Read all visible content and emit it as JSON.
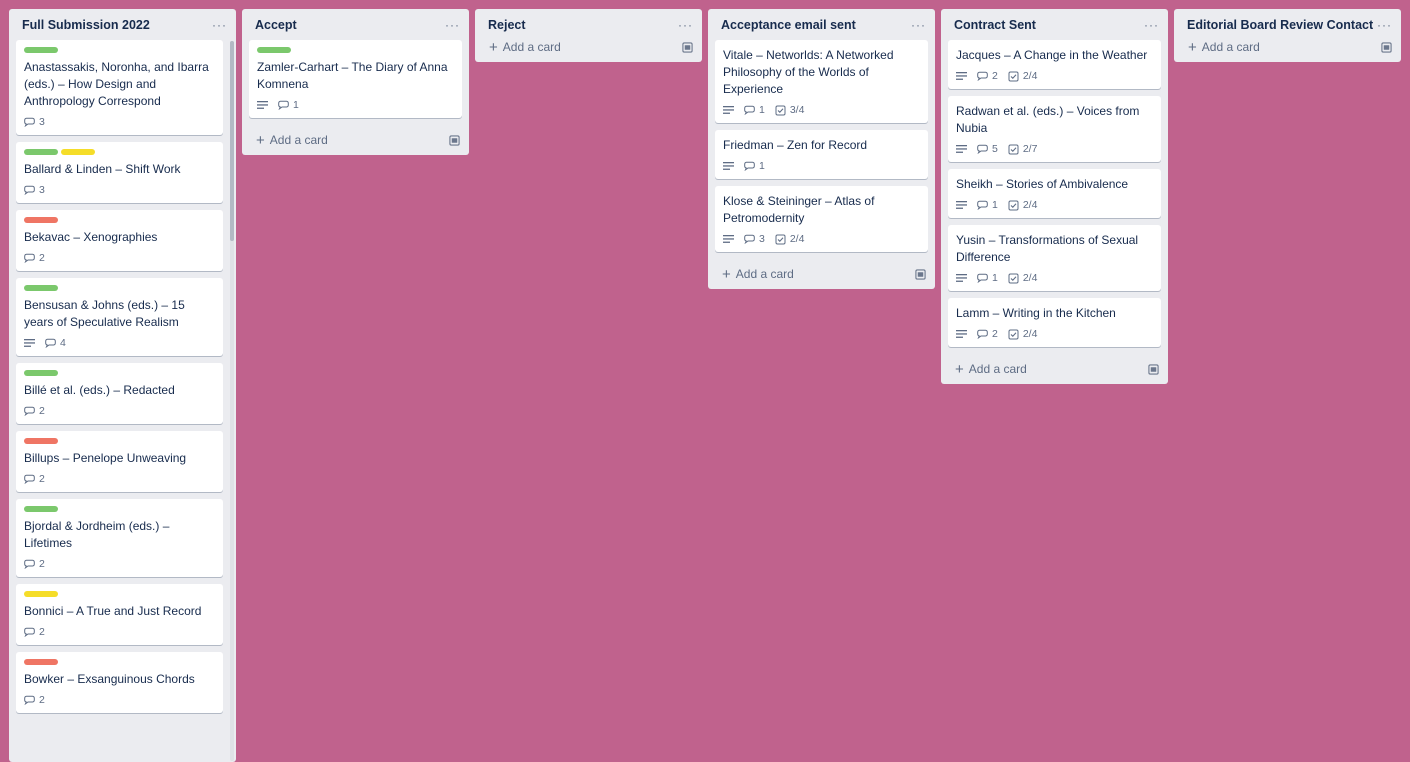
{
  "colors": {
    "background": "#c0628d",
    "list_bg": "#ebecf0",
    "green": "#7bc86c",
    "yellow": "#f5dd29",
    "red": "#ef7564"
  },
  "add_card_label": "Add a card",
  "lists": [
    {
      "title": "Full Submission 2022",
      "menu": "···",
      "cards": [
        {
          "labels": [
            "green"
          ],
          "title": "Anastassakis, Noronha, and Ibarra (eds.) – How Design and Anthropology Correspond",
          "comments": "3"
        },
        {
          "labels": [
            "green",
            "yellow"
          ],
          "title": "Ballard & Linden – Shift Work",
          "comments": "3"
        },
        {
          "labels": [
            "red"
          ],
          "title": "Bekavac – Xenographies",
          "comments": "2"
        },
        {
          "labels": [
            "green"
          ],
          "title": "Bensusan & Johns (eds.) – 15 years of Speculative Realism",
          "description": true,
          "comments": "4"
        },
        {
          "labels": [
            "green"
          ],
          "title": "Billé et al. (eds.) – Redacted",
          "comments": "2"
        },
        {
          "labels": [
            "red"
          ],
          "title": "Billups – Penelope Unweaving",
          "comments": "2"
        },
        {
          "labels": [
            "green"
          ],
          "title": "Bjordal & Jordheim (eds.) – Lifetimes",
          "comments": "2"
        },
        {
          "labels": [
            "yellow"
          ],
          "title": "Bonnici – A True and Just Record",
          "comments": "2"
        },
        {
          "labels": [
            "red"
          ],
          "title": "Bowker – Exsanguinous Chords",
          "comments": "2"
        }
      ]
    },
    {
      "title": "Accept",
      "menu": "···",
      "cards": [
        {
          "labels": [
            "green"
          ],
          "title": "Zamler-Carhart – The Diary of Anna Komnena",
          "description": true,
          "comments": "1"
        }
      ]
    },
    {
      "title": "Reject",
      "menu": "···",
      "cards": []
    },
    {
      "title": "Acceptance email sent",
      "menu": "···",
      "cards": [
        {
          "labels": [],
          "title": "Vitale – Networlds: A Networked Philosophy of the Worlds of Experience",
          "description": true,
          "comments": "1",
          "checklist": "3/4"
        },
        {
          "labels": [],
          "title": "Friedman – Zen for Record",
          "description": true,
          "comments": "1"
        },
        {
          "labels": [],
          "title": "Klose & Steininger – Atlas of Petromodernity",
          "description": true,
          "comments": "3",
          "checklist": "2/4"
        }
      ]
    },
    {
      "title": "Contract Sent",
      "menu": "···",
      "cards": [
        {
          "labels": [],
          "title": "Jacques – A Change in the Weather",
          "description": true,
          "comments": "2",
          "checklist": "2/4"
        },
        {
          "labels": [],
          "title": "Radwan et al. (eds.) – Voices from Nubia",
          "description": true,
          "comments": "5",
          "checklist": "2/7"
        },
        {
          "labels": [],
          "title": "Sheikh – Stories of Ambivalence",
          "description": true,
          "comments": "1",
          "checklist": "2/4"
        },
        {
          "labels": [],
          "title": "Yusin – Transformations of Sexual Difference",
          "description": true,
          "comments": "1",
          "checklist": "2/4"
        },
        {
          "labels": [],
          "title": "Lamm – Writing in the Kitchen",
          "description": true,
          "comments": "2",
          "checklist": "2/4"
        }
      ]
    },
    {
      "title": "Editorial Board Review Contact",
      "menu": "···",
      "cards": []
    }
  ]
}
